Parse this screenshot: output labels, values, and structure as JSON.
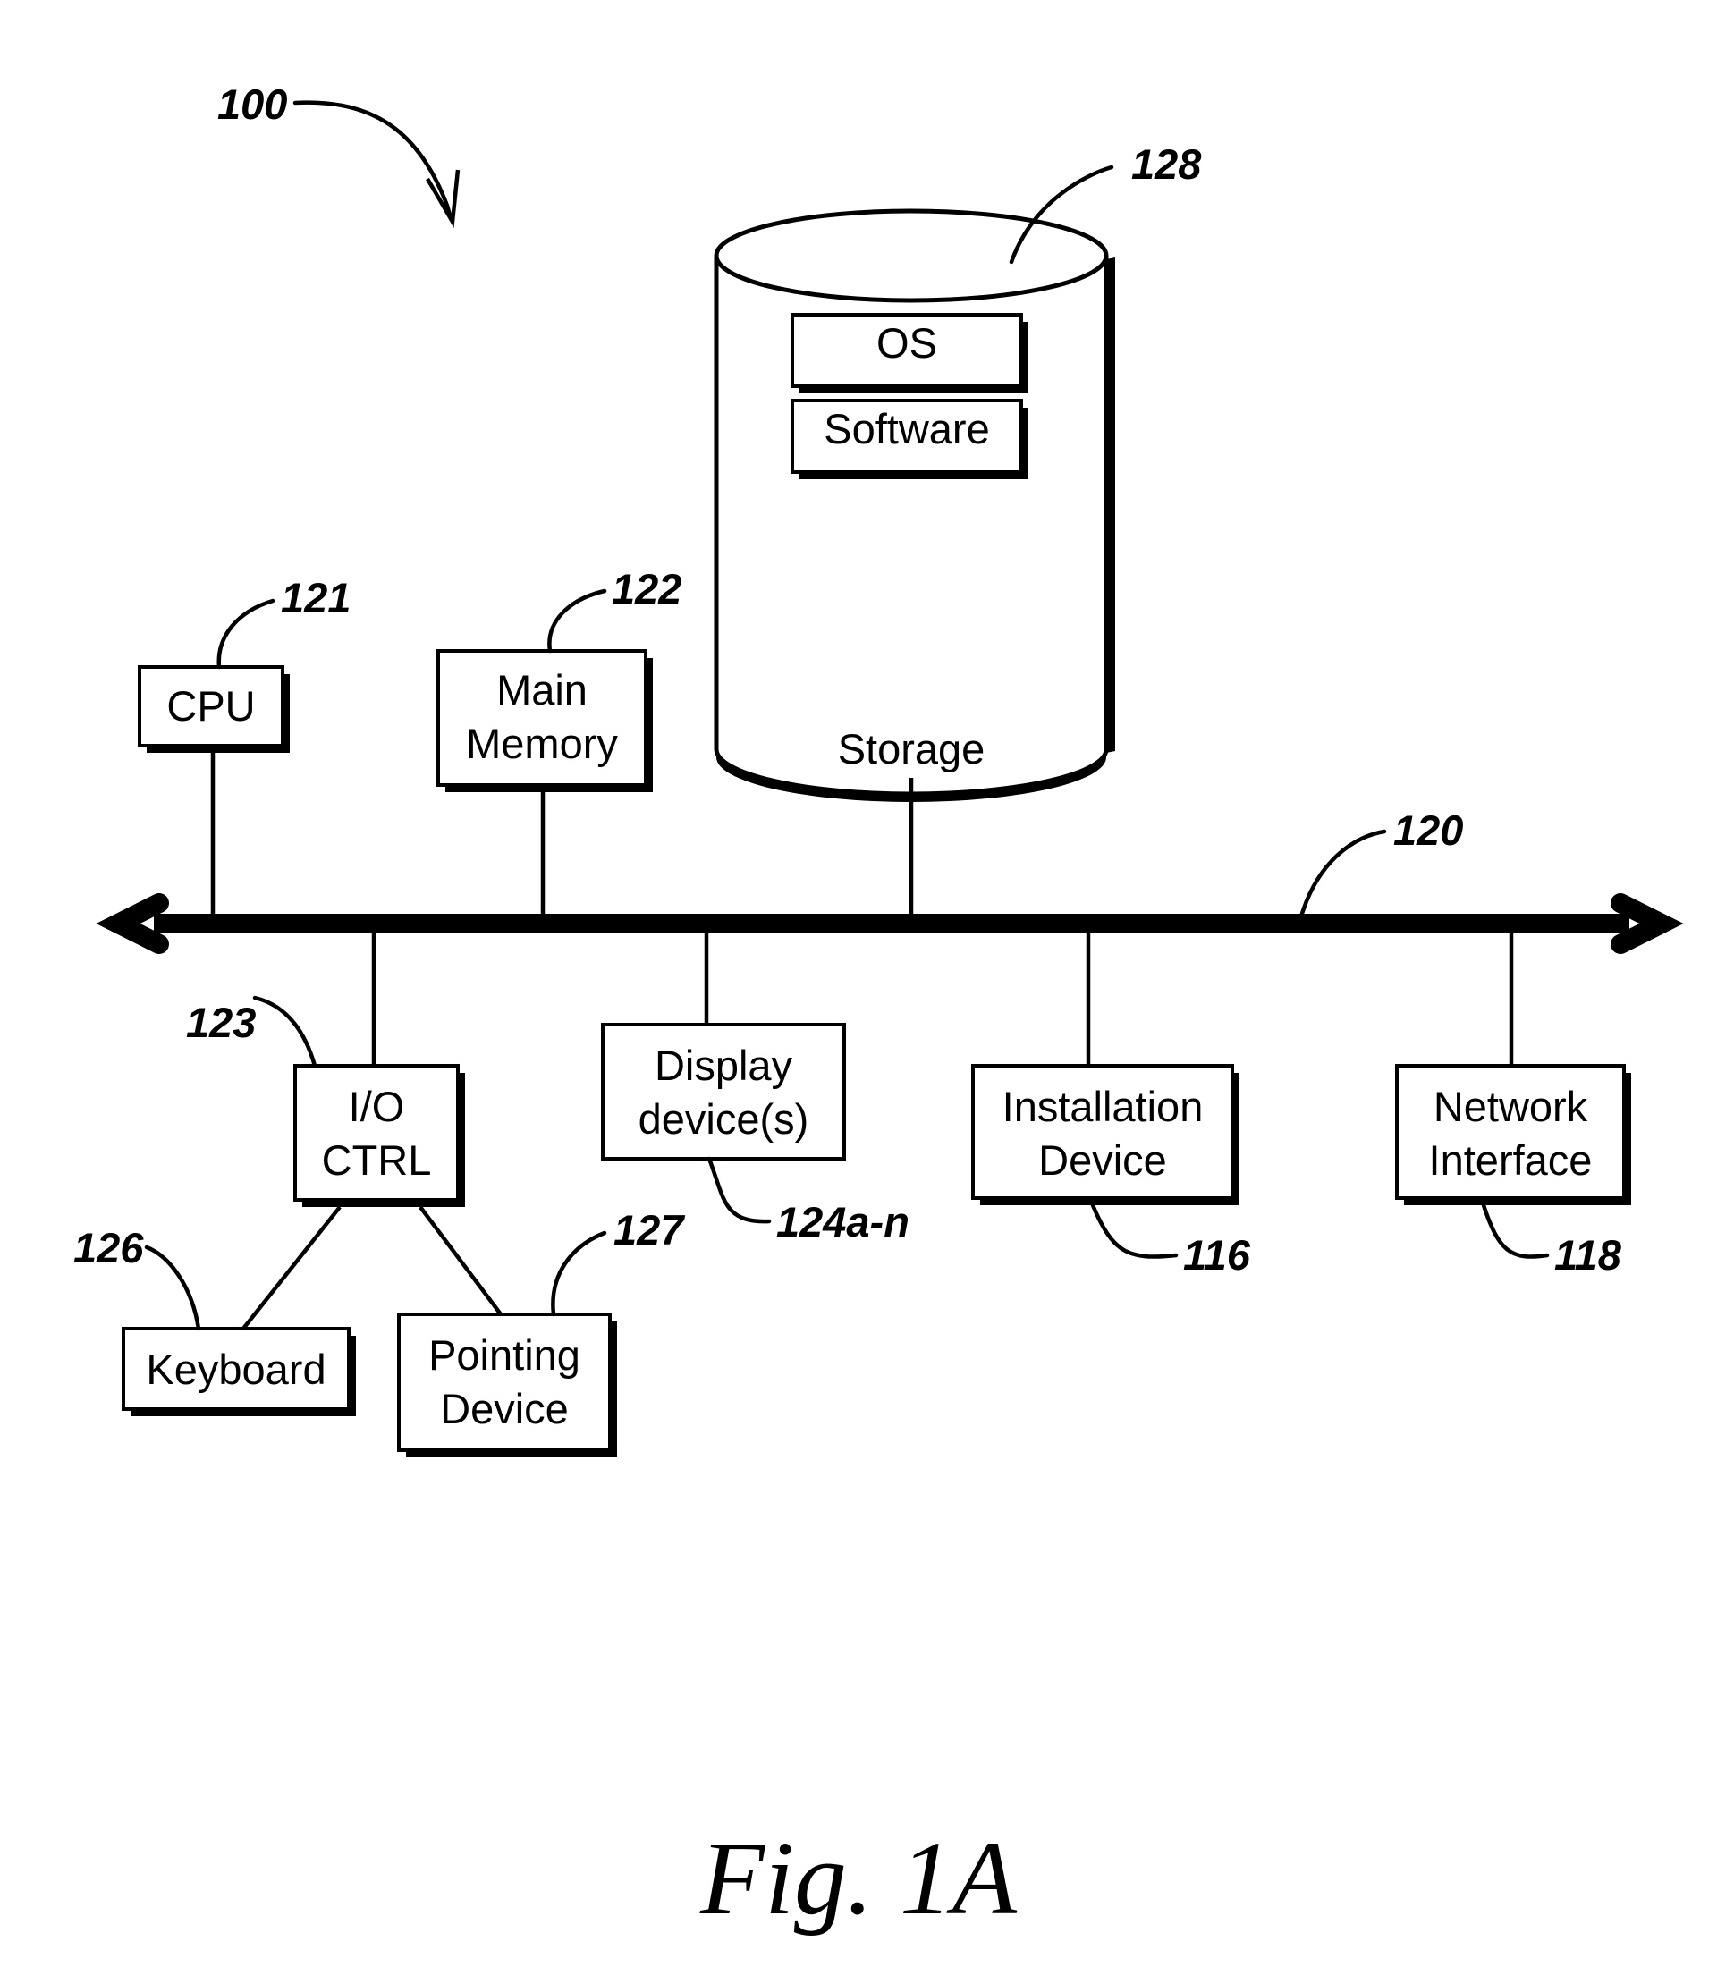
{
  "figure": {
    "caption": "Fig. 1A",
    "system_ref": "100"
  },
  "nodes": {
    "cpu": {
      "label": "CPU",
      "ref": "121"
    },
    "main_memory": {
      "label_line1": "Main",
      "label_line2": "Memory",
      "ref": "122"
    },
    "storage": {
      "label": "Storage",
      "ref": "128"
    },
    "storage_os": {
      "label": "OS"
    },
    "storage_software": {
      "label": "Software"
    },
    "bus": {
      "ref": "120"
    },
    "io_ctrl": {
      "label_line1": "I/O",
      "label_line2": "CTRL",
      "ref": "123"
    },
    "display_devices": {
      "label_line1": "Display",
      "label_line2": "device(s)",
      "ref": "124a-n"
    },
    "installation_device": {
      "label_line1": "Installation",
      "label_line2": "Device",
      "ref": "116"
    },
    "network_interface": {
      "label_line1": "Network",
      "label_line2": "Interface",
      "ref": "118"
    },
    "keyboard": {
      "label": "Keyboard",
      "ref": "126"
    },
    "pointing_device": {
      "label_line1": "Pointing",
      "label_line2": "Device",
      "ref": "127"
    }
  },
  "colors": {
    "line": "#000000",
    "background": "#ffffff"
  }
}
